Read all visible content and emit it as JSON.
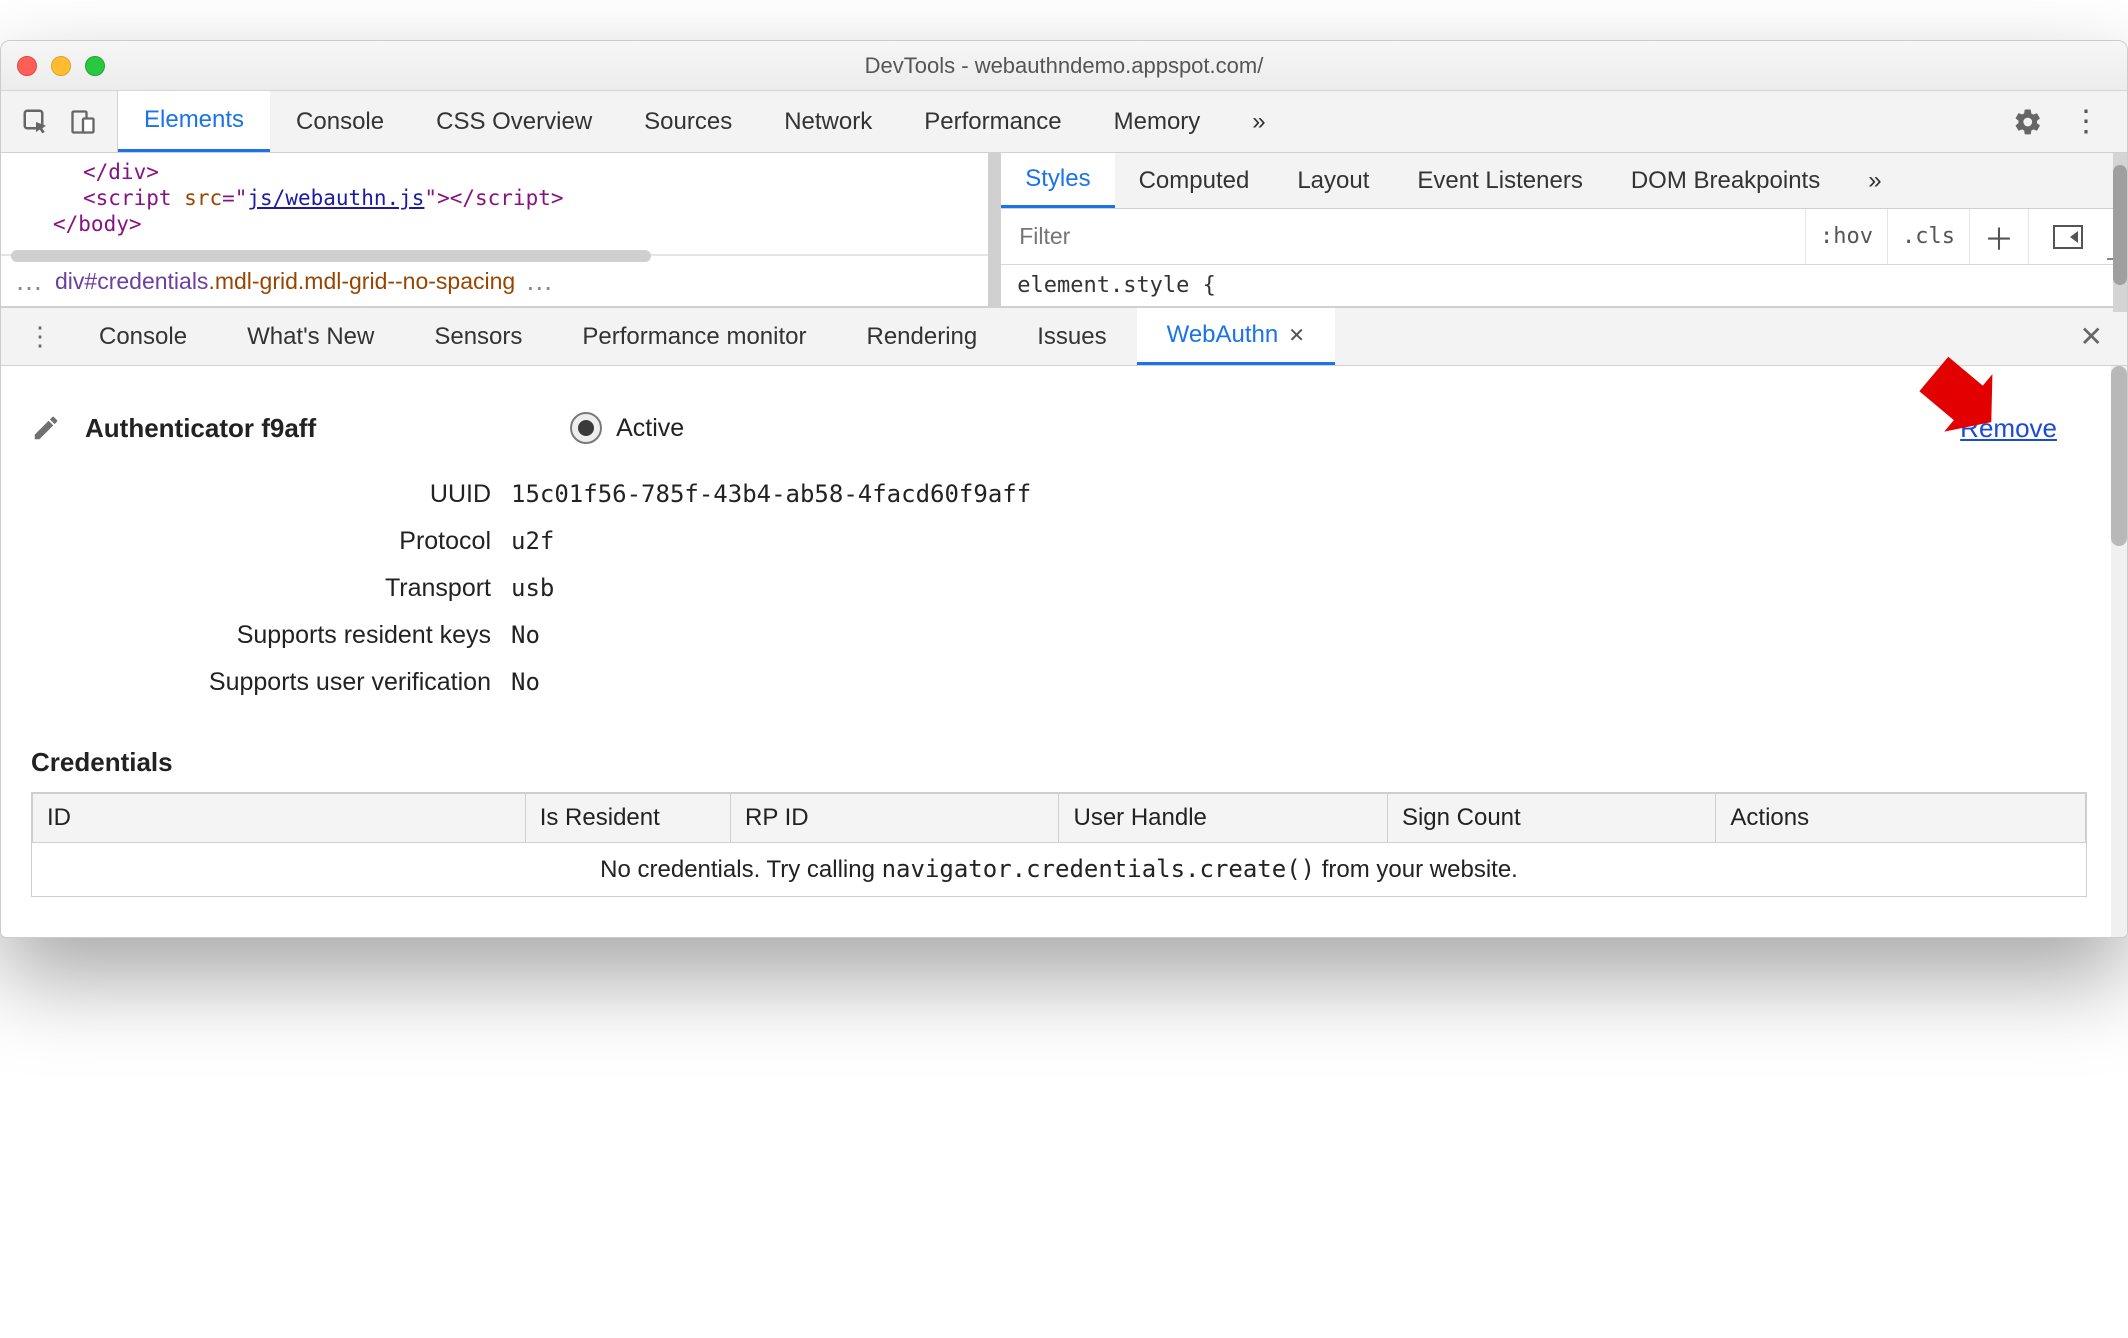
{
  "window_title": "DevTools - webauthndemo.appspot.com/",
  "main_tabs": {
    "items": [
      "Elements",
      "Console",
      "CSS Overview",
      "Sources",
      "Network",
      "Performance",
      "Memory"
    ],
    "active_index": 0
  },
  "elements_panel": {
    "lines": {
      "div_close": "</div>",
      "script_open_1": "<",
      "script_tag": "script",
      "src_name": "src",
      "src_val": "js/webauthn.js",
      "script_close_1": "></",
      "script_close_tag": "script",
      "script_close_2": ">",
      "body_close": "</body>"
    },
    "breadcrumb": {
      "sel_tag": "div",
      "sel_id": "#credentials",
      "sel_classes": ".mdl-grid.mdl-grid--no-spacing"
    }
  },
  "styles_panel": {
    "tabs": [
      "Styles",
      "Computed",
      "Layout",
      "Event Listeners",
      "DOM Breakpoints"
    ],
    "active_index": 0,
    "filter_placeholder": "Filter",
    "tool_hov": ":hov",
    "tool_cls": ".cls",
    "body_text": "element.style {"
  },
  "drawer": {
    "tabs": [
      "Console",
      "What's New",
      "Sensors",
      "Performance monitor",
      "Rendering",
      "Issues",
      "WebAuthn"
    ],
    "active_index": 6
  },
  "authenticator": {
    "title": "Authenticator f9aff",
    "active_label": "Active",
    "active": true,
    "remove_label": "Remove",
    "props": {
      "uuid_label": "UUID",
      "uuid": "15c01f56-785f-43b4-ab58-4facd60f9aff",
      "protocol_label": "Protocol",
      "protocol": "u2f",
      "transport_label": "Transport",
      "transport": "usb",
      "rk_label": "Supports resident keys",
      "rk": "No",
      "uv_label": "Supports user verification",
      "uv": "No"
    }
  },
  "credentials": {
    "heading": "Credentials",
    "columns": [
      "ID",
      "Is Resident",
      "RP ID",
      "User Handle",
      "Sign Count",
      "Actions"
    ],
    "empty_pre": "No credentials. Try calling ",
    "empty_code": "navigator.credentials.create()",
    "empty_post": " from your website."
  }
}
